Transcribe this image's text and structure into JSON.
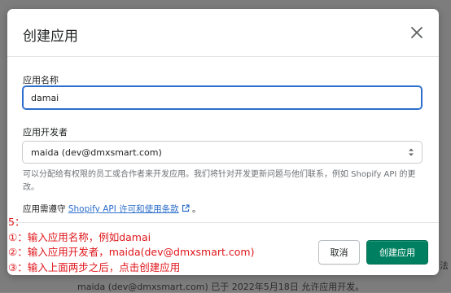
{
  "modal": {
    "title": "创建应用",
    "app_name_label": "应用名称",
    "app_name_value": "damai",
    "developer_label": "应用开发者",
    "developer_value": "maida (dev@dmxsmart.com)",
    "help_text": "可以分配给有权限的员工或合作者来开发应用。我们将针对开发更新问题与他们联系，例如 Shopify API 的更改。",
    "terms_prefix": "应用需遵守 ",
    "terms_link": "Shopify API 许可和使用条款",
    "terms_suffix": " 。",
    "cancel_label": "取消",
    "create_label": "创建应用"
  },
  "annotations": {
    "step": "5：",
    "line1": "①：输入应用名称，例如damai",
    "line2": "②：输入应用开发者，maida(dev@dmxsmart.com)",
    "line3": "③：输入上面两步之后，点击创建应用",
    "color": "#e0161b"
  },
  "background": {
    "footer_text": "maida (dev@dmxsmart.com) 已于 2022年5月18日 允许应用开发。",
    "edge_text": "法"
  },
  "colors": {
    "accent": "#2c6ecb",
    "primary_button": "#008060"
  }
}
